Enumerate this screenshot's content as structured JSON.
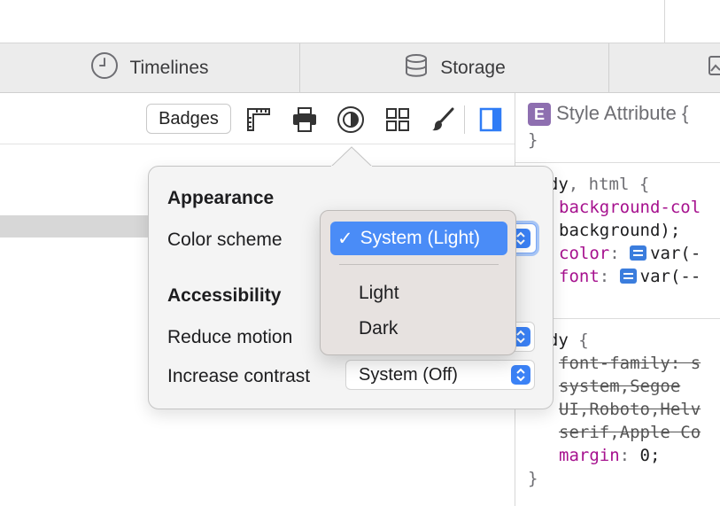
{
  "tabs": [
    {
      "label": "Timelines",
      "icon": "clock-icon"
    },
    {
      "label": "Storage",
      "icon": "database-icon"
    }
  ],
  "toolbar": {
    "badges_label": "Badges",
    "icons": [
      "ruler-icon",
      "print-icon",
      "appearance-icon",
      "grid-icon",
      "paintbrush-icon",
      "sidebar-toggle-icon"
    ]
  },
  "styles_panel": {
    "style_attribute": {
      "badge": "E",
      "label": "Style Attribute",
      "open": "{",
      "close": "}"
    },
    "rule1": {
      "selector_a": "body",
      "comma": ",",
      "selector_b": "html",
      "open": "{",
      "decl1_prop": "background-col",
      "decl1_cont": "background);",
      "decl2_prop": "color",
      "decl2_val": "var(-",
      "decl3_prop": "font",
      "decl3_val": "var(--"
    },
    "rule2": {
      "selector": "body",
      "open": "{",
      "struck_line1": "font-family: s",
      "struck_line2": "system,Segoe",
      "struck_line3": "UI,Roboto,Helv",
      "struck_line4": "serif,Apple Co",
      "margin_prop": "margin",
      "margin_val": "0;",
      "close": "}"
    }
  },
  "popover": {
    "appearance_heading": "Appearance",
    "color_scheme_label": "Color scheme",
    "accessibility_heading": "Accessibility",
    "reduce_motion_label": "Reduce motion",
    "increase_contrast_label": "Increase contrast",
    "increase_contrast_value": "System (Off)"
  },
  "color_scheme_menu": {
    "checkmark": "✓",
    "selected": "System (Light)",
    "options": [
      "Light",
      "Dark"
    ]
  },
  "colors": {
    "accent": "#4a8cf7",
    "property": "#a6118e"
  }
}
